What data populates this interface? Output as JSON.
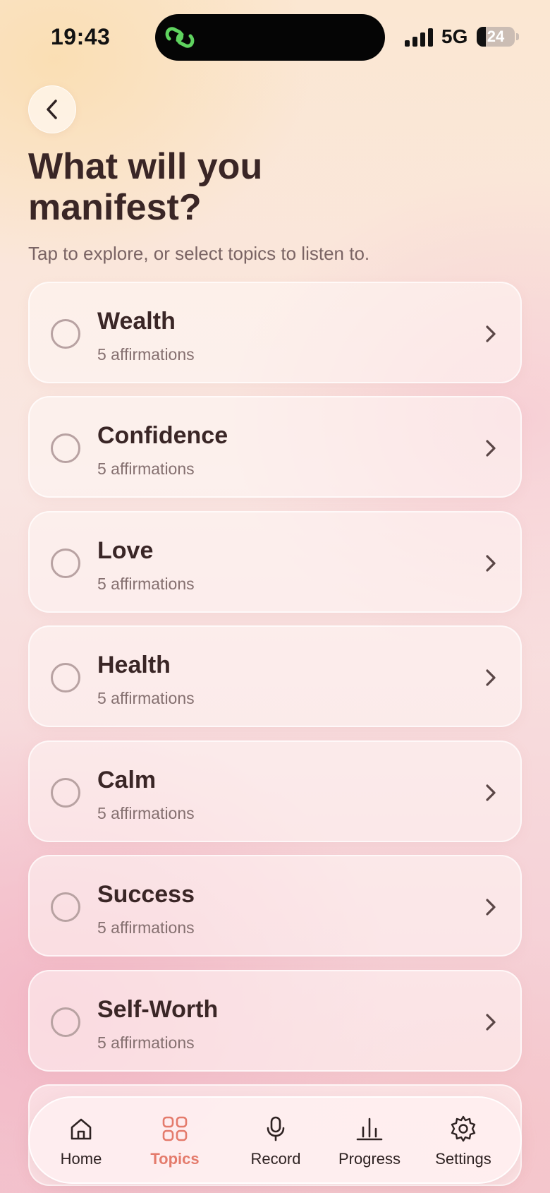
{
  "status_bar": {
    "time": "19:43",
    "network": "5G",
    "battery": "24"
  },
  "header": {
    "title": "What will you manifest?",
    "subtitle": "Tap to explore, or select topics to listen to."
  },
  "topics": [
    {
      "name": "Wealth",
      "count": "5 affirmations"
    },
    {
      "name": "Confidence",
      "count": "5 affirmations"
    },
    {
      "name": "Love",
      "count": "5 affirmations"
    },
    {
      "name": "Health",
      "count": "5 affirmations"
    },
    {
      "name": "Calm",
      "count": "5 affirmations"
    },
    {
      "name": "Success",
      "count": "5 affirmations"
    },
    {
      "name": "Self-Worth",
      "count": "5 affirmations"
    }
  ],
  "nav": {
    "items": [
      {
        "label": "Home",
        "icon": "home-icon"
      },
      {
        "label": "Topics",
        "icon": "grid-icon",
        "active": true
      },
      {
        "label": "Record",
        "icon": "microphone-icon"
      },
      {
        "label": "Progress",
        "icon": "bar-chart-icon"
      },
      {
        "label": "Settings",
        "icon": "gear-icon"
      }
    ]
  },
  "colors": {
    "accent": "#e47b6c",
    "text": "#3a2626",
    "island_icon": "#5fd35f"
  }
}
